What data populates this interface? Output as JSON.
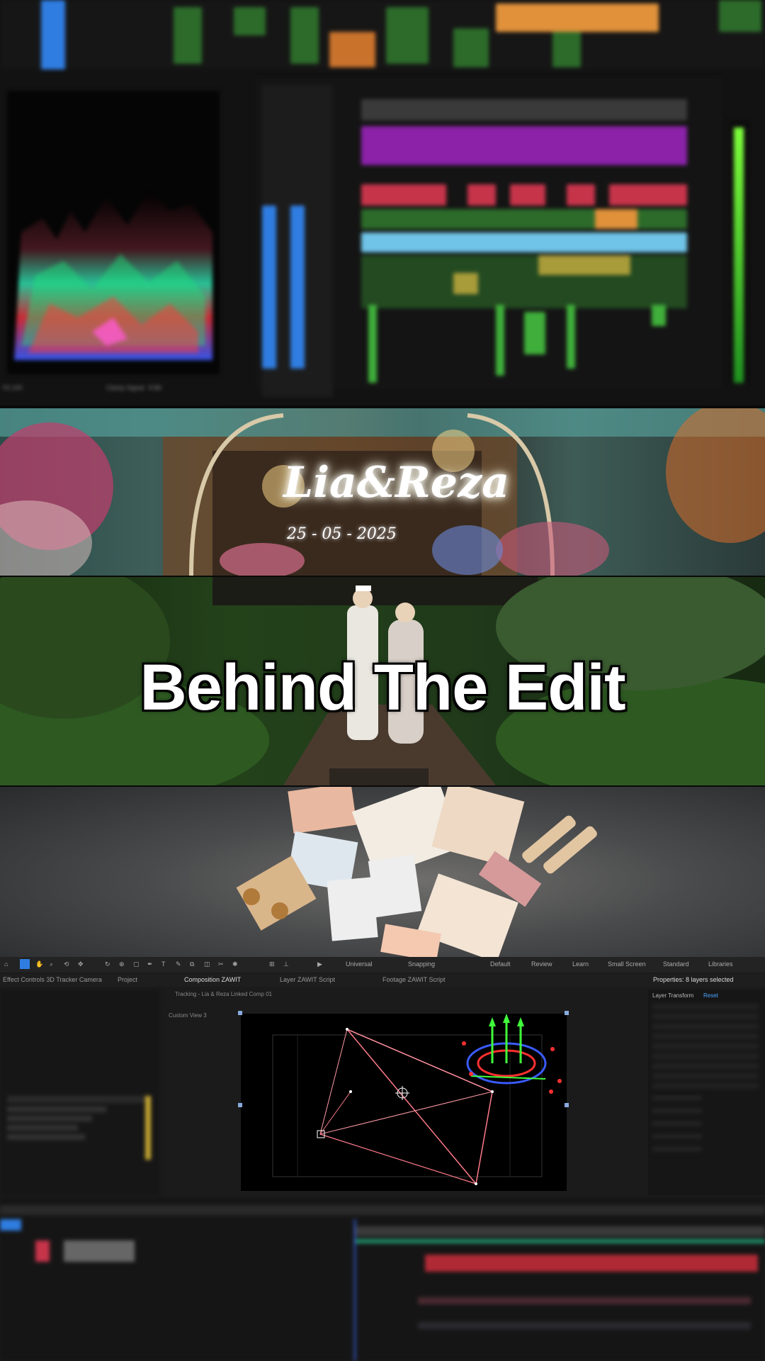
{
  "premiere": {
    "scope_footer": {
      "zoom": "Fit 100",
      "mode_label": "Clamp Signal",
      "bits": "8 Bit"
    }
  },
  "overlay": {
    "names": "Lia&Reza",
    "date": "25 - 05 - 2025",
    "headline": "Behind The Edit"
  },
  "after_effects": {
    "toolbar": {
      "snap_universal": "Universal",
      "snapping": "Snapping",
      "workspaces": [
        "Default",
        "Review",
        "Learn",
        "Small Screen",
        "Standard",
        "Libraries"
      ]
    },
    "tabs": {
      "effect_controls": "Effect Controls 3D Tracker Camera",
      "project": "Project",
      "composition": "Composition ZAWIT",
      "layer": "Layer ZAWIT Script",
      "footage": "Footage ZAWIT Script",
      "properties": "Properties: 8 layers selected"
    },
    "properties": {
      "section": "Layer Transform",
      "reset": "Reset"
    },
    "comp_breadcrumb": "Tracking - Lia & Reza Linked Comp 01",
    "comp_view_label": "Custom View 3"
  },
  "colors": {
    "accent_blue": "#2f7de1",
    "purple_clip": "#8b22a8",
    "green_clip": "#3fae3a",
    "orange_clip": "#e0913a",
    "cyan_clip": "#6fc4e8",
    "red_clip": "#c6344a"
  }
}
